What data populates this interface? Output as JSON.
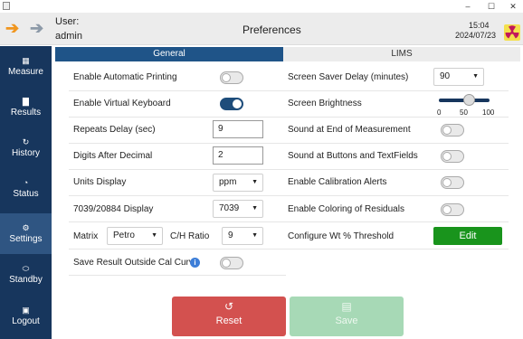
{
  "window": {
    "controls": [
      "–",
      "☐",
      "✕"
    ]
  },
  "header": {
    "user_label": "User:",
    "user_name": "admin",
    "title": "Preferences",
    "time": "15:04",
    "date": "2024/07/23"
  },
  "sidebar": {
    "items": [
      {
        "label": "Measure",
        "icon": "measure-icon"
      },
      {
        "label": "Results",
        "icon": "chart-icon"
      },
      {
        "label": "History",
        "icon": "history-icon"
      },
      {
        "label": "Status",
        "icon": "gauge-icon"
      },
      {
        "label": "Settings",
        "icon": "gear-icon"
      },
      {
        "label": "Standby",
        "icon": "standby-icon"
      },
      {
        "label": "Logout",
        "icon": "lock-icon"
      }
    ],
    "active": "Settings"
  },
  "tabs": {
    "general": "General",
    "lims": "LIMS"
  },
  "left": {
    "auto_printing": {
      "label": "Enable Automatic Printing",
      "on": false
    },
    "virtual_keyboard": {
      "label": "Enable Virtual Keyboard",
      "on": true
    },
    "repeats_delay": {
      "label": "Repeats Delay (sec)",
      "value": "9"
    },
    "digits_after_decimal": {
      "label": "Digits After Decimal",
      "value": "2"
    },
    "units_display": {
      "label": "Units Display",
      "value": "ppm"
    },
    "display_7039": {
      "label": "7039/20884 Display",
      "value": "7039"
    },
    "matrix": {
      "label": "Matrix",
      "value": "Petro"
    },
    "ch_ratio": {
      "label": "C/H Ratio",
      "value": "9"
    },
    "save_outside_cal": {
      "label": "Save Result Outside Cal Curve",
      "on": false
    }
  },
  "right": {
    "screen_saver": {
      "label": "Screen Saver Delay (minutes)",
      "value": "90"
    },
    "screen_brightness": {
      "label": "Screen Brightness",
      "value": 60,
      "min": "0",
      "mid": "50",
      "max": "100"
    },
    "sound_end_measurement": {
      "label": "Sound at End of Measurement",
      "on": false
    },
    "sound_buttons": {
      "label": "Sound at Buttons and TextFields",
      "on": false
    },
    "calibration_alerts": {
      "label": "Enable Calibration Alerts",
      "on": false
    },
    "coloring_residuals": {
      "label": "Enable Coloring of Residuals",
      "on": false
    },
    "wt_threshold": {
      "label": "Configure Wt % Threshold",
      "button": "Edit"
    }
  },
  "actions": {
    "reset": "Reset",
    "save": "Save"
  },
  "colors": {
    "sidebar": "#17365d",
    "tab_active": "#1f5488",
    "edit": "#19941c",
    "reset": "#d3514f",
    "save_disabled": "#a7d9b6",
    "back_arrow": "#f0961f"
  }
}
